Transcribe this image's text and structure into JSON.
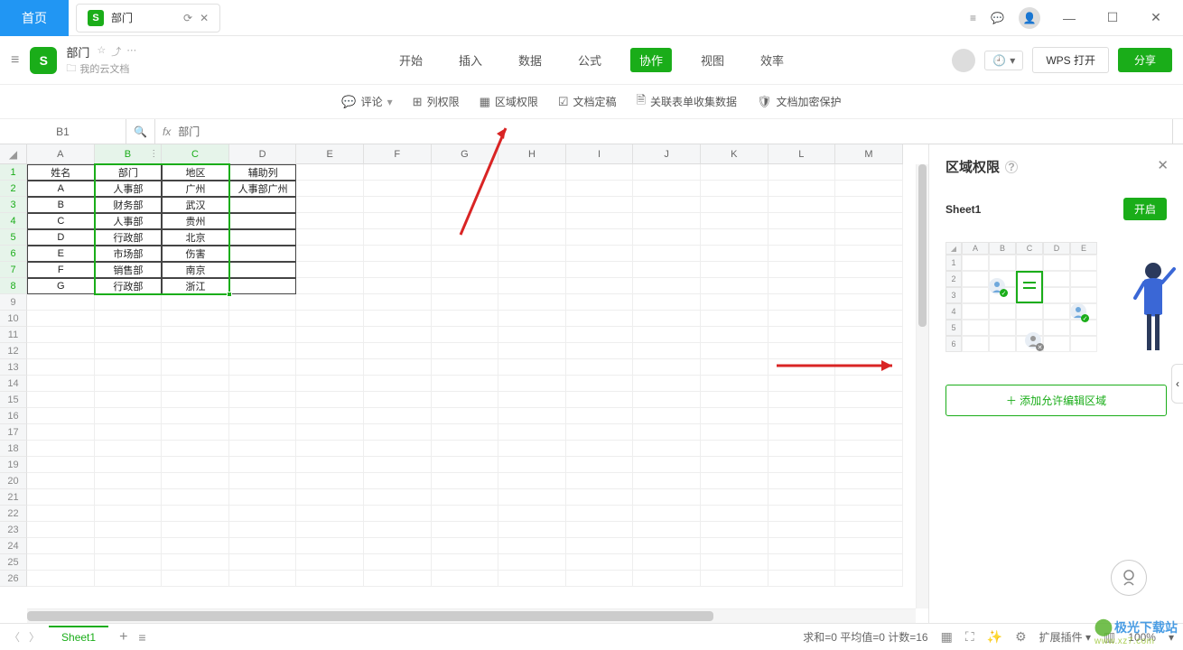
{
  "titlebar": {
    "home": "首页",
    "doc_name": "部门"
  },
  "header": {
    "doc_title": "部门",
    "location": "我的云文档",
    "open_label": "WPS 打开",
    "share_label": "分享"
  },
  "menu": {
    "items": [
      "开始",
      "插入",
      "数据",
      "公式",
      "协作",
      "视图",
      "效率"
    ],
    "active_index": 4
  },
  "toolbar": {
    "comment": "评论",
    "col_perm": "列权限",
    "region_perm": "区域权限",
    "doc_finalize": "文档定稿",
    "link_form": "关联表单收集数据",
    "encrypt": "文档加密保护"
  },
  "formula": {
    "cell_ref": "B1",
    "value": "部门"
  },
  "columns": [
    "A",
    "B",
    "C",
    "D",
    "E",
    "F",
    "G",
    "H",
    "I",
    "J",
    "K",
    "L",
    "M"
  ],
  "row_count": 26,
  "grid": {
    "header_row": [
      "姓名",
      "部门",
      "地区",
      "辅助列"
    ],
    "rows": [
      [
        "A",
        "人事部",
        "广州",
        "人事部广州"
      ],
      [
        "B",
        "财务部",
        "武汉",
        ""
      ],
      [
        "C",
        "人事部",
        "贵州",
        ""
      ],
      [
        "D",
        "行政部",
        "北京",
        ""
      ],
      [
        "E",
        "市场部",
        "伤害",
        ""
      ],
      [
        "F",
        "销售部",
        "南京",
        ""
      ],
      [
        "G",
        "行政部",
        "浙江",
        ""
      ]
    ]
  },
  "panel": {
    "title": "区域权限",
    "sheet": "Sheet1",
    "enable": "开启",
    "add_region": "添加允许编辑区域",
    "mini_cols": [
      "A",
      "B",
      "C",
      "D",
      "E"
    ],
    "mini_rows": [
      "1",
      "2",
      "3",
      "4",
      "5",
      "6"
    ]
  },
  "bottom": {
    "sheet_tab": "Sheet1",
    "status_text": "求和=0 平均值=0 计数=16",
    "ext_label": "扩展插件",
    "zoom": "100%"
  },
  "watermark": {
    "line1": "极光下载站",
    "line2": "www.xz7.com"
  }
}
